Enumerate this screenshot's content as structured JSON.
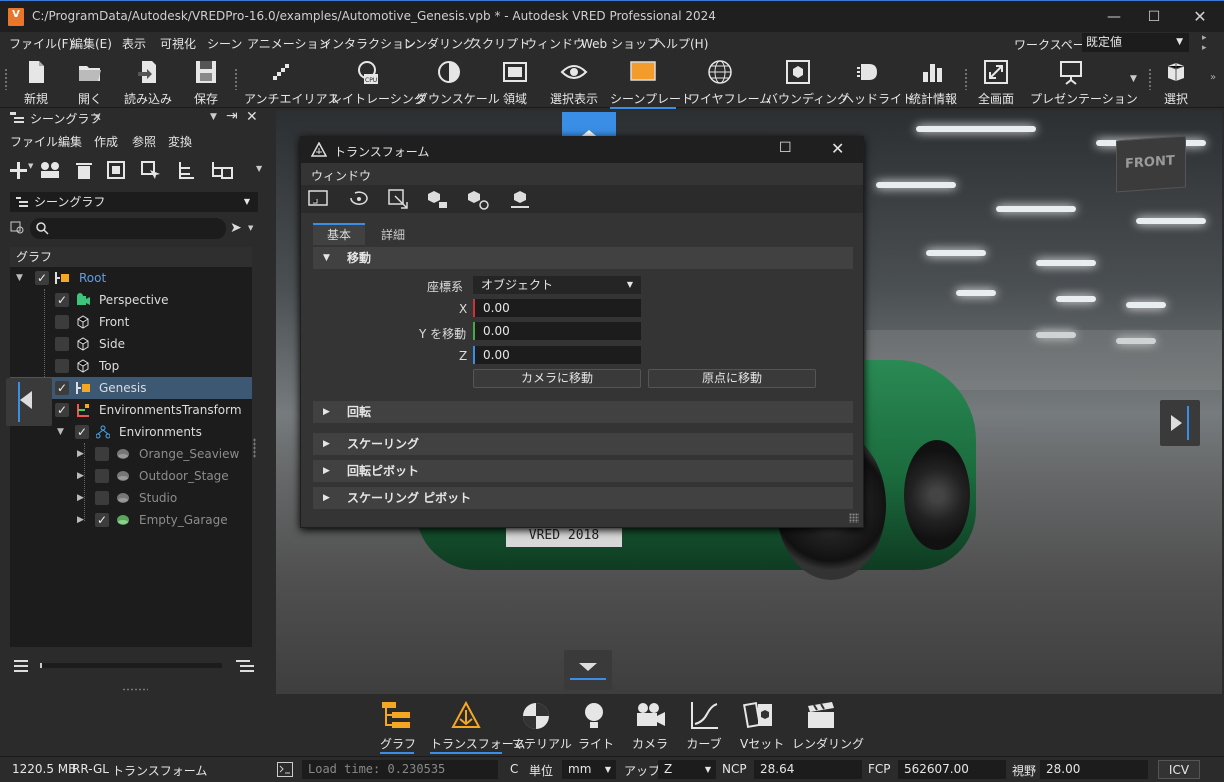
{
  "window": {
    "app_badge": "V",
    "title": "C:/ProgramData/Autodesk/VREDPro-16.0/examples/Automotive_Genesis.vpb * - Autodesk VRED Professional 2024"
  },
  "menu": [
    "ファイル(F)",
    "編集(E)",
    "表示",
    "可視化",
    "シーン",
    "アニメーション",
    "インタラクション",
    "レンダリング",
    "スクリプト",
    "ウィンドウ",
    "Web ショップ",
    "ヘルプ(H)"
  ],
  "workspace": {
    "label": "ワークスペース",
    "value": "既定値"
  },
  "toolbar": [
    {
      "label": "新規",
      "icon": "new-file-icon"
    },
    {
      "label": "開く",
      "icon": "open-folder-icon"
    },
    {
      "label": "読み込み",
      "icon": "import-icon"
    },
    {
      "label": "保存",
      "icon": "save-icon"
    },
    {
      "label": "アンチエイリアス",
      "icon": "antialias-icon"
    },
    {
      "label": "レイトレーシング",
      "icon": "raytracing-cpu-icon"
    },
    {
      "label": "ダウンスケール",
      "icon": "downscale-icon"
    },
    {
      "label": "領域",
      "icon": "region-icon"
    },
    {
      "label": "選択表示",
      "icon": "eye-icon"
    },
    {
      "label": "シーンプレート",
      "icon": "sceneplate-icon"
    },
    {
      "label": "ワイヤフレーム",
      "icon": "wireframe-globe-icon"
    },
    {
      "label": "バウンディング",
      "icon": "bounding-box-icon"
    },
    {
      "label": "ヘッドライト",
      "icon": "headlight-icon"
    },
    {
      "label": "統計情報",
      "icon": "statistics-icon"
    },
    {
      "label": "全画面",
      "icon": "fullscreen-icon"
    },
    {
      "label": "プレゼンテーション",
      "icon": "presentation-icon"
    },
    {
      "label": "選択",
      "icon": "select-icon"
    }
  ],
  "scenegraph": {
    "title": "シーングラフ",
    "submenu": [
      "ファイル",
      "編集",
      "作成",
      "参照",
      "変換"
    ],
    "dropdown": "シーングラフ",
    "search_placeholder": "",
    "header": "グラフ",
    "nodes": [
      {
        "label": "Root",
        "checked": true,
        "color": "#5aa0e8"
      },
      {
        "label": "Perspective",
        "checked": true,
        "color": "#e6e6e6"
      },
      {
        "label": "Front",
        "checked": false,
        "color": "#e6e6e6"
      },
      {
        "label": "Side",
        "checked": false,
        "color": "#e6e6e6"
      },
      {
        "label": "Top",
        "checked": false,
        "color": "#e6e6e6"
      },
      {
        "label": "Genesis",
        "checked": true,
        "color": "#e6e6e6"
      },
      {
        "label": "EnvironmentsTransform",
        "checked": true,
        "color": "#e6e6e6"
      },
      {
        "label": "Environments",
        "checked": true,
        "color": "#e6e6e6"
      },
      {
        "label": "Orange_Seaview",
        "checked": false,
        "color": "#8c8c8c"
      },
      {
        "label": "Outdoor_Stage",
        "checked": false,
        "color": "#8c8c8c"
      },
      {
        "label": "Studio",
        "checked": false,
        "color": "#8c8c8c"
      },
      {
        "label": "Empty_Garage",
        "checked": true,
        "color": "#8c8c8c"
      }
    ]
  },
  "viewport": {
    "cube_label": "FRONT",
    "plate_text": "VRED 2018"
  },
  "transform_dialog": {
    "title": "トランスフォーム",
    "menu": "ウィンドウ",
    "tabs": [
      "基本",
      "詳細"
    ],
    "move_section": "移動",
    "coord_label": "座標系",
    "coord_value": "オブジェクト",
    "x_label": "X",
    "x_value": "0.00",
    "y_label": "Y を移動",
    "y_value": "0.00",
    "z_label": "Z",
    "z_value": "0.00",
    "btn_camera": "カメラに移動",
    "btn_origin": "原点に移動",
    "sections": [
      "回転",
      "スケーリング",
      "回転ピボット",
      "スケーリング ピボット"
    ]
  },
  "bottom_tabs": [
    {
      "label": "グラフ",
      "icon": "graph-icon"
    },
    {
      "label": "トランスフォーム",
      "icon": "transform-icon"
    },
    {
      "label": "マテリアル",
      "icon": "material-icon"
    },
    {
      "label": "ライト",
      "icon": "light-bulb-icon"
    },
    {
      "label": "カメラ",
      "icon": "camera-icon"
    },
    {
      "label": "カーブ",
      "icon": "curve-icon"
    },
    {
      "label": "Vセット",
      "icon": "vset-icon"
    },
    {
      "label": "レンダリング",
      "icon": "clapper-icon"
    }
  ],
  "status": {
    "memory": "1220.5 MB",
    "renderer": "RR-GL",
    "module": "トランスフォーム",
    "console": "Load time: 0.230535",
    "c_label": "C",
    "unit_label": "単位",
    "unit_value": "mm",
    "up_label": "アップ",
    "up_value": "Z",
    "ncp_label": "NCP",
    "ncp_value": "28.64",
    "fcp_label": "FCP",
    "fcp_value": "562607.00",
    "fov_label": "視野",
    "fov_value": "28.00",
    "icv": "ICV"
  },
  "colors": {
    "accent": "#3a8ee6",
    "orange": "#f5a623",
    "selection": "#3d5873"
  }
}
